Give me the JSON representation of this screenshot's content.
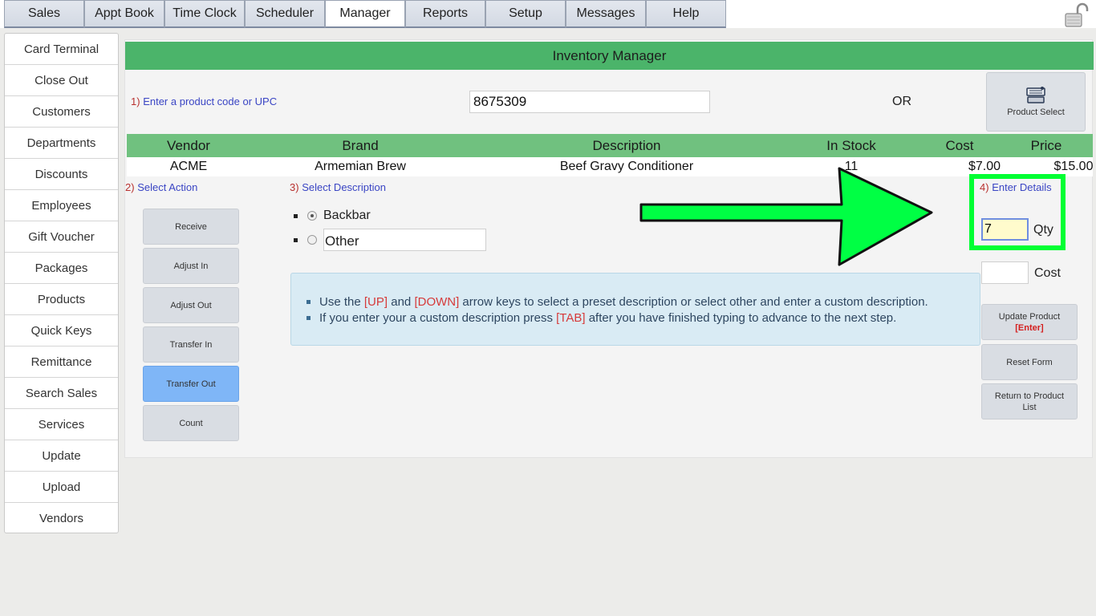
{
  "tabs": [
    {
      "label": "Sales"
    },
    {
      "label": "Appt Book"
    },
    {
      "label": "Time Clock"
    },
    {
      "label": "Scheduler"
    },
    {
      "label": "Manager"
    },
    {
      "label": "Reports"
    },
    {
      "label": "Setup"
    },
    {
      "label": "Messages"
    },
    {
      "label": "Help"
    }
  ],
  "active_tab": "Manager",
  "sidebar": {
    "items": [
      {
        "label": "Card Terminal"
      },
      {
        "label": "Close Out"
      },
      {
        "label": "Customers"
      },
      {
        "label": "Departments"
      },
      {
        "label": "Discounts"
      },
      {
        "label": "Employees"
      },
      {
        "label": "Gift Voucher"
      },
      {
        "label": "Packages"
      },
      {
        "label": "Products"
      },
      {
        "label": "Quick Keys"
      },
      {
        "label": "Remittance"
      },
      {
        "label": "Search Sales"
      },
      {
        "label": "Services"
      },
      {
        "label": "Update"
      },
      {
        "label": "Upload"
      },
      {
        "label": "Vendors"
      }
    ]
  },
  "main": {
    "title": "Inventory Manager",
    "step1": {
      "num": "1)",
      "label": "Enter a product code or UPC"
    },
    "code_value": "8675309",
    "or_label": "OR",
    "product_select_label": "Product Select",
    "table": {
      "headers": [
        "Vendor",
        "Brand",
        "Description",
        "In Stock",
        "Cost",
        "Price"
      ],
      "row": [
        "ACME",
        "Armemian Brew",
        "Beef Gravy Conditioner",
        "11",
        "$7.00",
        "$15.00"
      ]
    },
    "step2": {
      "num": "2)",
      "label": "Select Action"
    },
    "actions": [
      {
        "label": "Receive"
      },
      {
        "label": "Adjust In"
      },
      {
        "label": "Adjust Out"
      },
      {
        "label": "Transfer In"
      },
      {
        "label": "Transfer Out"
      },
      {
        "label": "Count"
      }
    ],
    "selected_action": "Transfer Out",
    "step3": {
      "num": "3)",
      "label": "Select Description"
    },
    "descriptions": {
      "backbar": "Backbar",
      "other_value": "Other"
    },
    "info": {
      "line1": {
        "a": "Use the ",
        "k1": "[UP]",
        "b": " and ",
        "k2": "[DOWN]",
        "c": " arrow keys to select a preset description or select other and enter a custom description."
      },
      "line2": {
        "a": "If you enter your a custom description press ",
        "k1": "[TAB]",
        "b": " after you have finished typing to advance to the next step."
      }
    },
    "step4": {
      "num": "4)",
      "label": "Enter Details"
    },
    "qty_value": "7",
    "qty_label": "Qty",
    "cost_value": "",
    "cost_label": "Cost",
    "buttons": {
      "update_label": "Update Product",
      "update_key": "[Enter]",
      "reset_label": "Reset Form",
      "return_label": "Return to Product List"
    }
  },
  "colors": {
    "header_green": "#4bb46a",
    "table_green": "#70c17f",
    "highlight_green": "#00ff33",
    "selected_blue": "#7fb6f7",
    "step_blue": "#3a45c4",
    "step_red": "#b8312f"
  },
  "icons": [
    "lock-icon",
    "product-select-icon",
    "annotation-arrow"
  ]
}
